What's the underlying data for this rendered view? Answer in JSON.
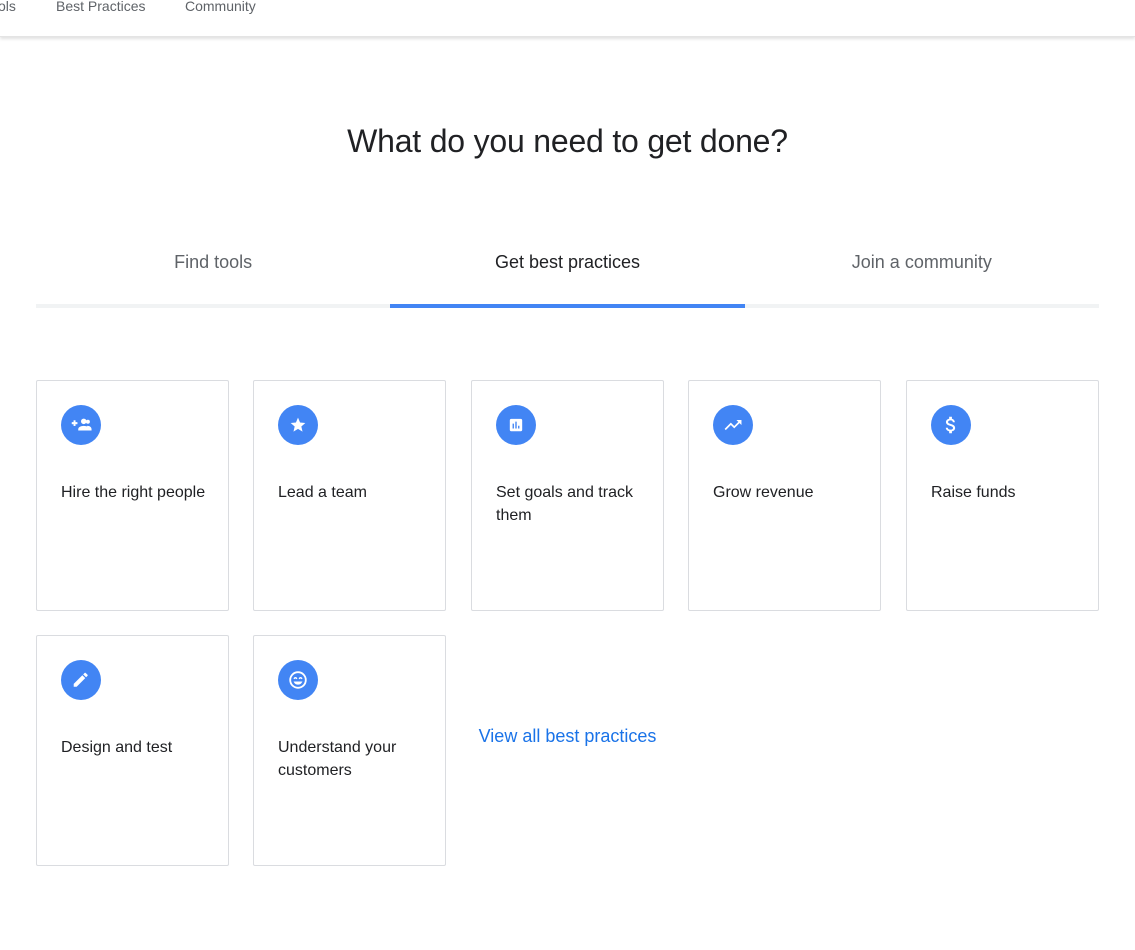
{
  "topnav": {
    "items": [
      "ols",
      "Best Practices",
      "Community"
    ]
  },
  "headline": "What do you need to get done?",
  "tabs": [
    {
      "label": "Find tools",
      "active": false
    },
    {
      "label": "Get best practices",
      "active": true
    },
    {
      "label": "Join a community",
      "active": false
    }
  ],
  "cards": [
    {
      "label": "Hire the right people",
      "icon": "add-group-icon"
    },
    {
      "label": "Lead a team",
      "icon": "star-icon"
    },
    {
      "label": "Set goals and track them",
      "icon": "bar-chart-icon"
    },
    {
      "label": "Grow revenue",
      "icon": "trending-up-icon"
    },
    {
      "label": "Raise funds",
      "icon": "dollar-icon"
    },
    {
      "label": "Design and test",
      "icon": "pencil-icon"
    },
    {
      "label": "Understand your customers",
      "icon": "smiley-icon"
    }
  ],
  "view_all_label": "View all best practices",
  "colors": {
    "accent": "#4285f4",
    "link": "#1a73e8"
  }
}
